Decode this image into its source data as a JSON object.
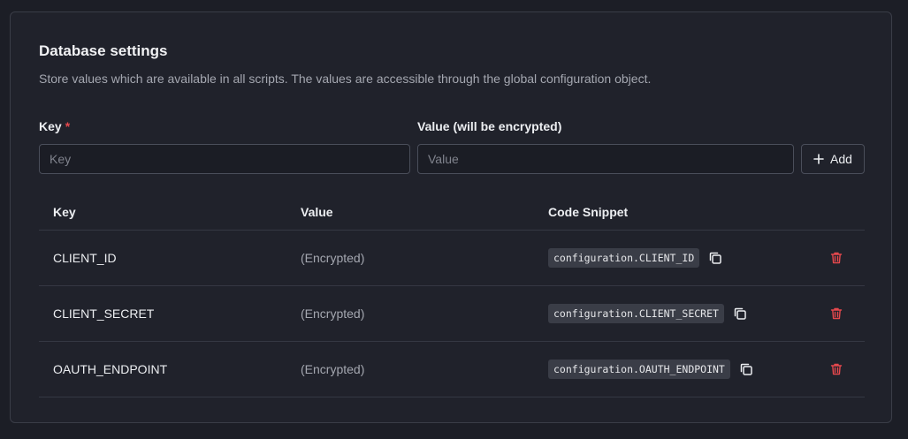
{
  "header": {
    "title": "Database settings",
    "description": "Store values which are available in all scripts. The values are accessible through the global configuration object."
  },
  "form": {
    "key_label": "Key",
    "required_mark": "*",
    "value_label": "Value (will be encrypted)",
    "key_placeholder": "Key",
    "value_placeholder": "Value",
    "add_label": "Add"
  },
  "table": {
    "columns": [
      "Key",
      "Value",
      "Code Snippet"
    ],
    "rows": [
      {
        "key": "CLIENT_ID",
        "value": "(Encrypted)",
        "snippet": "configuration.CLIENT_ID"
      },
      {
        "key": "CLIENT_SECRET",
        "value": "(Encrypted)",
        "snippet": "configuration.CLIENT_SECRET"
      },
      {
        "key": "OAUTH_ENDPOINT",
        "value": "(Encrypted)",
        "snippet": "configuration.OAUTH_ENDPOINT"
      }
    ]
  },
  "icons": {
    "add": "plus-icon",
    "copy": "copy-icon",
    "delete": "trash-icon"
  },
  "colors": {
    "background": "#1c1e26",
    "card": "#20222b",
    "required": "#e5484d",
    "delete": "#e5484d",
    "code_bg": "#3a3d47"
  }
}
